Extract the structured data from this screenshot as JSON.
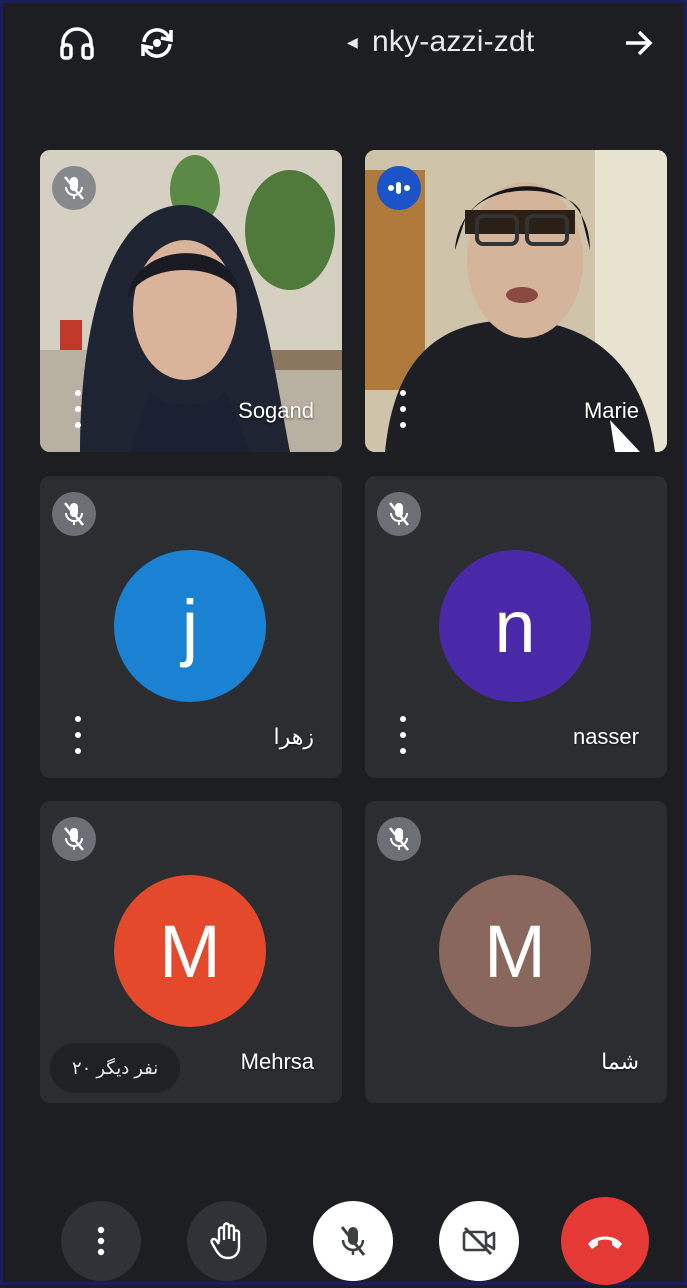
{
  "header": {
    "meeting_code": "nky-azzi-zdt",
    "audio_icon": "headphones-icon",
    "switch_camera_icon": "switch-camera-icon",
    "forward_icon": "arrow-right-icon"
  },
  "tiles": [
    {
      "name": "Sogand",
      "type": "video",
      "mic": "muted"
    },
    {
      "name": "Marie",
      "type": "video",
      "mic": "speaking"
    },
    {
      "name": "زهرا",
      "initial": "j",
      "color": "#1b82d3",
      "mic": "muted"
    },
    {
      "name": "nasser",
      "initial": "n",
      "color": "#4a29a8",
      "mic": "muted"
    },
    {
      "name": "Mehrsa",
      "initial": "M",
      "color": "#e4492c",
      "mic": "muted",
      "more_label": "۲۰ نفر دیگر"
    },
    {
      "name": "شما",
      "initial": "M",
      "color": "#8a675d",
      "mic": "muted"
    }
  ],
  "controls": {
    "more_icon": "more-vert-icon",
    "hand_icon": "raise-hand-icon",
    "mic_icon": "mic-off-icon",
    "camera_icon": "video-off-icon",
    "end_call_icon": "end-call-icon",
    "end_call_color": "#e53935"
  }
}
